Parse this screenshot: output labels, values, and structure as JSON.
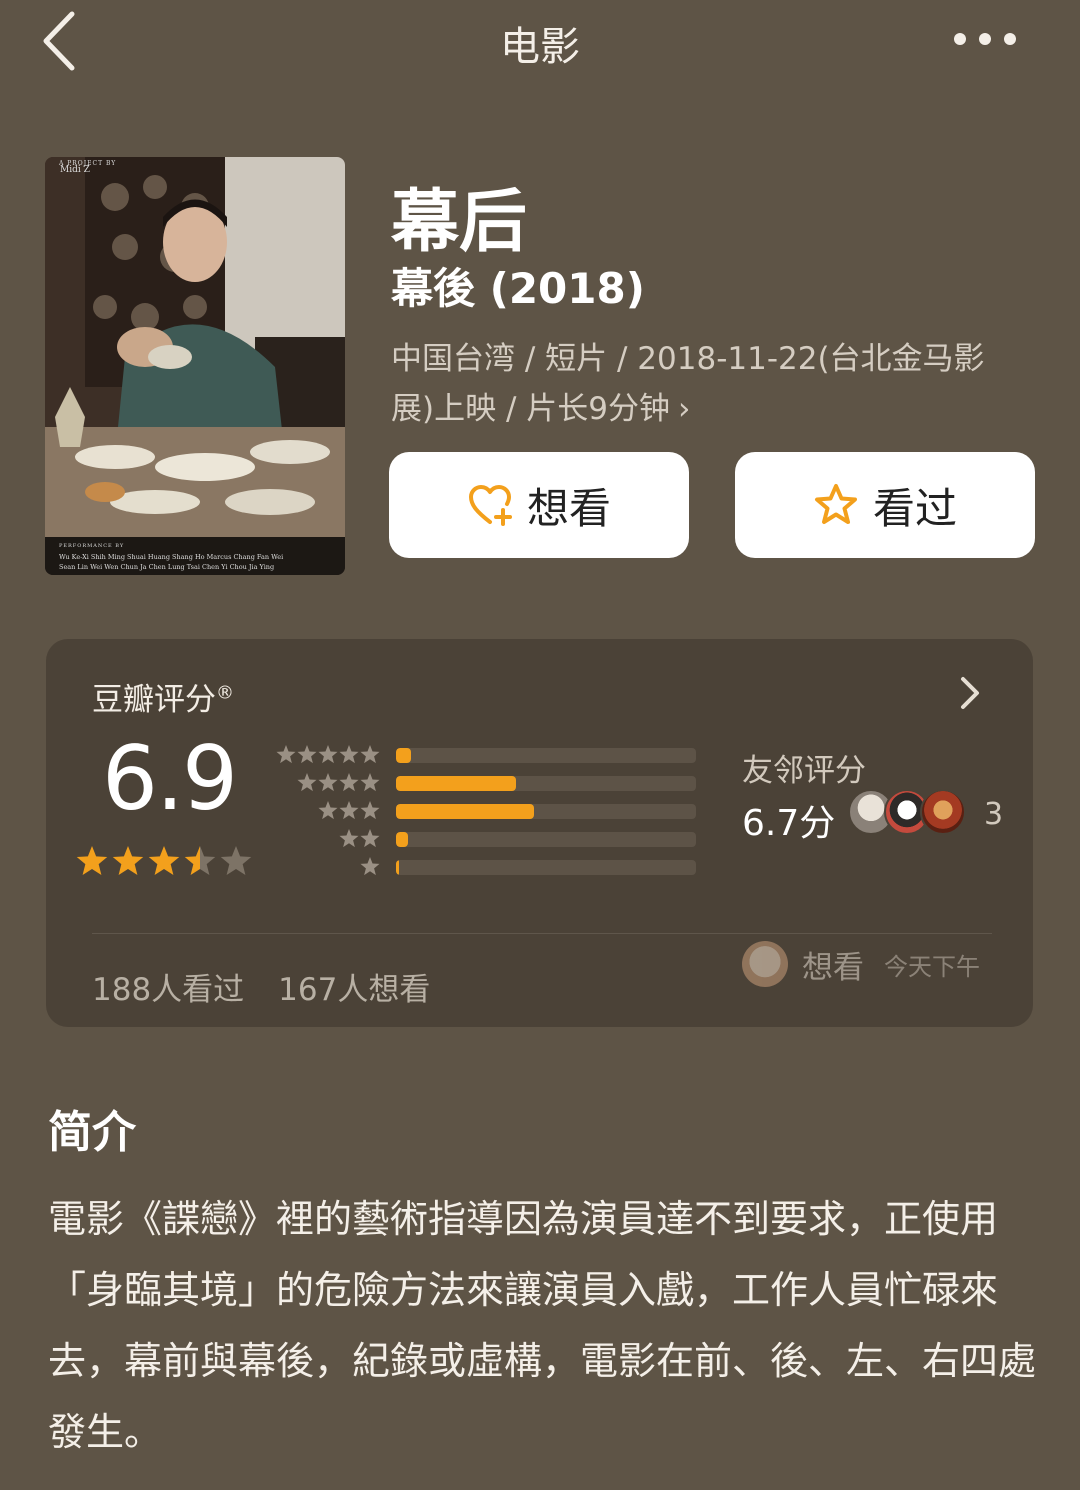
{
  "header": {
    "title": "电影"
  },
  "poster": {
    "project_line": "A PROJECT BY",
    "director": "Midi Z",
    "performance_label": "PERFORMANCE BY",
    "cast_line_1": "Wu Ke-Xi   Shih Ming Shuai   Huang Shang Ho   Marcus Chang   Fan Wei",
    "cast_line_2": "Sean Lin   Wei Wen Chun   Ja Chen Lung   Tsai Chen Yi   Chou Jia Ying"
  },
  "movie": {
    "title": "幕后",
    "original_title": "幕後 (2018)",
    "meta": "中国台湾 / 短片 / 2018-11-22(台北金马影展)上映 / 片长9分钟",
    "meta_arrow": "›"
  },
  "actions": {
    "want_label": "想看",
    "seen_label": "看过"
  },
  "rating": {
    "label": "豆瓣评分",
    "mark": "®",
    "score": "6.9",
    "stars": 3.5,
    "distribution_percent": {
      "5": 5,
      "4": 40,
      "3": 46,
      "2": 4,
      "1": 1
    },
    "friends_label": "友邻评分",
    "friends_score": "6.7分",
    "friends_count": "3",
    "seen_count": "188人看过",
    "want_count": "167人想看",
    "activity_verb": "想看",
    "activity_time": "今天下午"
  },
  "intro": {
    "title": "简介",
    "text": "電影《諜戀》裡的藝術指導因為演員達不到要求，正使用「身臨其境」的危險方法來讓演員入戲，工作人員忙碌來去，幕前與幕後，紀錄或虛構，電影在前、後、左、右四處發生。"
  },
  "colors": {
    "background": "#5e5446",
    "card": "#4b4237",
    "accent": "#f3a01c",
    "bar_track": "#5d5347"
  }
}
